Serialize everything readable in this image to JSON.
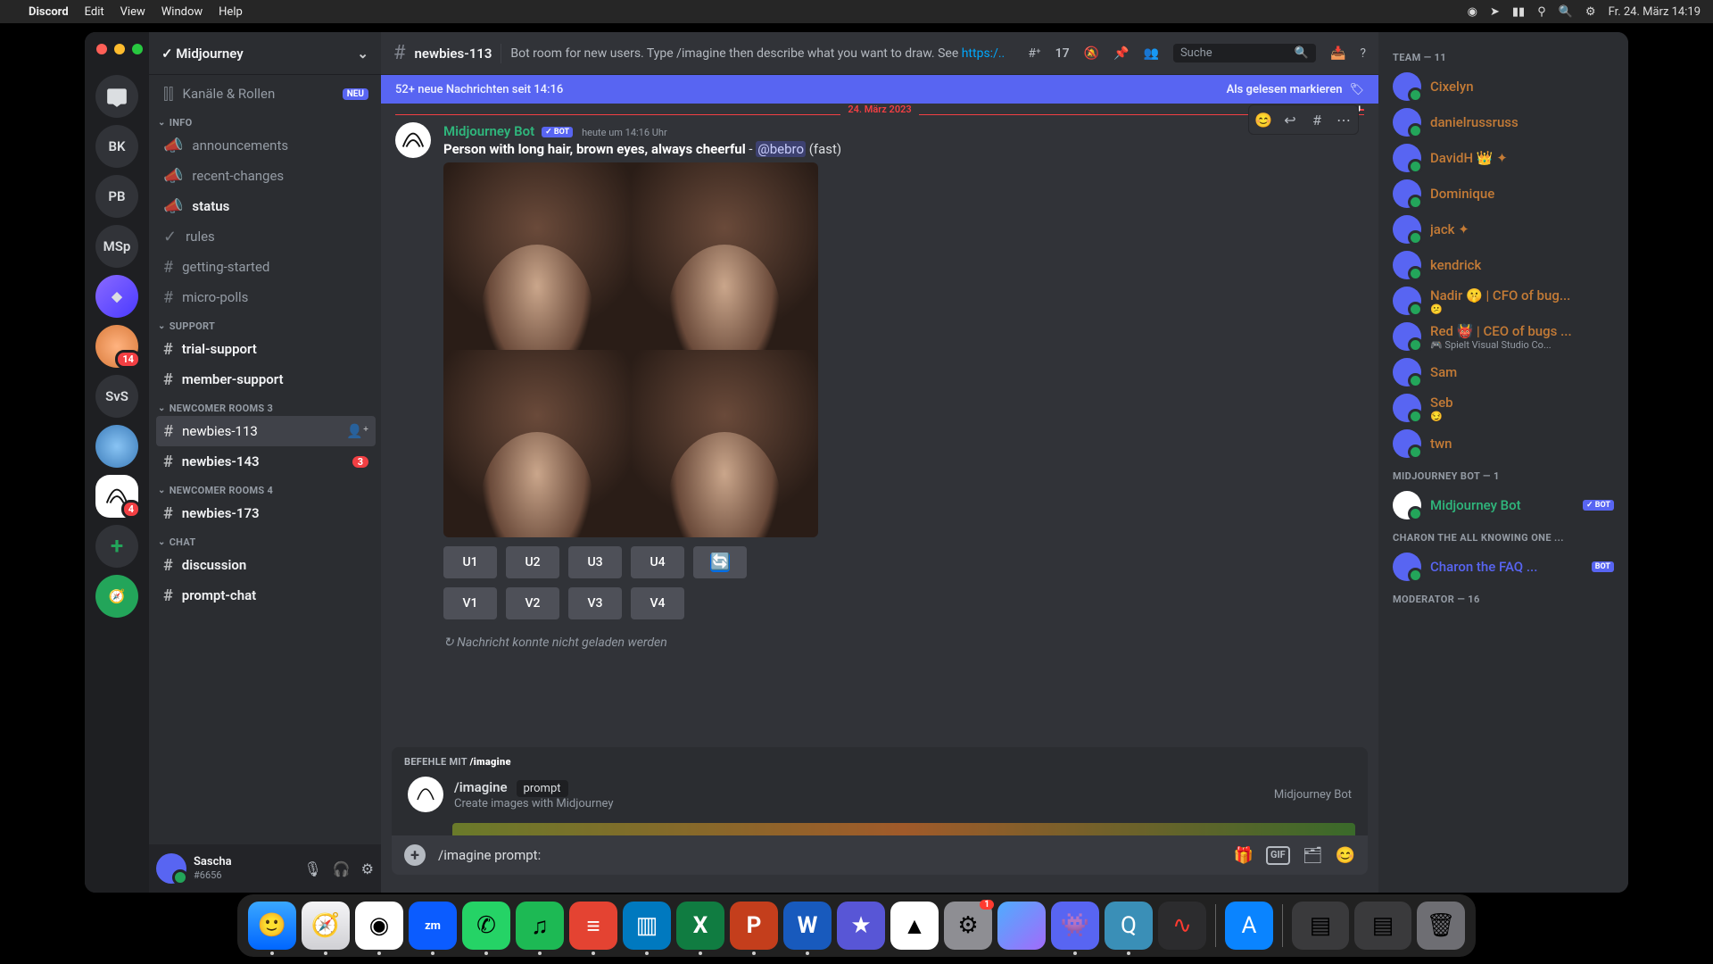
{
  "menubar": {
    "app": "Discord",
    "items": [
      "Edit",
      "View",
      "Window",
      "Help"
    ],
    "clock": "Fr. 24. März  14:19"
  },
  "server": {
    "name": "Midjourney"
  },
  "rail": {
    "items": [
      {
        "k": "home",
        "label": ""
      },
      {
        "k": "bk",
        "label": "BK"
      },
      {
        "k": "pb",
        "label": "PB"
      },
      {
        "k": "msp",
        "label": "MSp"
      },
      {
        "k": "guild1",
        "label": ""
      },
      {
        "k": "guild2",
        "label": "",
        "badge": "14"
      },
      {
        "k": "svs",
        "label": "SvS"
      },
      {
        "k": "guild3",
        "label": ""
      },
      {
        "k": "mj",
        "label": "",
        "badge": "4"
      }
    ]
  },
  "sidebar": {
    "channels_roles": "Kanäle & Rollen",
    "neu_pill": "NEU",
    "cats": [
      {
        "name": "INFO",
        "items": [
          {
            "icon": "megaphone",
            "label": "announcements"
          },
          {
            "icon": "megaphone",
            "label": "recent-changes"
          },
          {
            "icon": "megaphone",
            "label": "status",
            "bold": true
          },
          {
            "icon": "check",
            "label": "rules"
          },
          {
            "icon": "hash",
            "label": "getting-started"
          },
          {
            "icon": "hash",
            "label": "micro-polls"
          }
        ]
      },
      {
        "name": "SUPPORT",
        "items": [
          {
            "icon": "hash",
            "label": "trial-support",
            "bold": true
          },
          {
            "icon": "hash",
            "label": "member-support",
            "bold": true
          }
        ]
      },
      {
        "name": "NEWCOMER ROOMS 3",
        "items": [
          {
            "icon": "hash",
            "label": "newbies-113",
            "active": true,
            "addperson": true
          },
          {
            "icon": "hash",
            "label": "newbies-143",
            "bold": true,
            "count": "3"
          }
        ]
      },
      {
        "name": "NEWCOMER ROOMS 4",
        "items": [
          {
            "icon": "hash",
            "label": "newbies-173",
            "bold": true
          }
        ]
      },
      {
        "name": "CHAT",
        "items": [
          {
            "icon": "hash",
            "label": "discussion",
            "bold": true
          },
          {
            "icon": "hash",
            "label": "prompt-chat",
            "bold": true
          }
        ]
      }
    ]
  },
  "user": {
    "name": "Sascha",
    "tag": "#6656"
  },
  "channel": {
    "hash": "#",
    "name": "newbies-113",
    "topic_pre": "Bot room for new users. Type /imagine then describe what you want to draw. See ",
    "topic_link": "https:/..",
    "threads_count": "17",
    "search_placeholder": "Suche"
  },
  "banner": {
    "text": "52+ neue Nachrichten seit 14:16",
    "mark": "Als gelesen markieren"
  },
  "date_divider": "24. März 2023",
  "neu_badge": "NEU",
  "msg": {
    "author": "Midjourney Bot",
    "bot": "✓ BOT",
    "time": "heute um 14:16 Uhr",
    "prompt_bold": "Person with long hair, brown eyes, always cheerful",
    "prompt_sep": " - ",
    "mention": "@bebro",
    "suffix": " (fast)",
    "u": [
      "U1",
      "U2",
      "U3",
      "U4"
    ],
    "v": [
      "V1",
      "V2",
      "V3",
      "V4"
    ]
  },
  "loadfail": "Nachricht konnte nicht geladen werden",
  "cmd": {
    "title_pre": "BEFEHLE MIT ",
    "title_cmd": "/imagine",
    "name": "/imagine",
    "param": "prompt",
    "desc": "Create images with Midjourney",
    "source": "Midjourney Bot"
  },
  "input": "/imagine prompt:",
  "members": {
    "team_h": "TEAM — 11",
    "team": [
      {
        "n": "Cixelyn",
        "s": ""
      },
      {
        "n": "danielrussruss",
        "s": ""
      },
      {
        "n": "DavidH 👑 ✦",
        "s": ""
      },
      {
        "n": "Dominique",
        "s": ""
      },
      {
        "n": "jack ✦",
        "s": ""
      },
      {
        "n": "kendrick",
        "s": ""
      },
      {
        "n": "Nadir 🤫 | CFO of bug...",
        "s": "😕"
      },
      {
        "n": "Red 👹 | CEO of bugs ...",
        "s": "🎮 Spielt Visual Studio Co..."
      },
      {
        "n": "Sam",
        "s": ""
      },
      {
        "n": "Seb",
        "s": "😏"
      },
      {
        "n": "twn",
        "s": ""
      }
    ],
    "bot_h": "MIDJOURNEY BOT — 1",
    "bot": "Midjourney Bot",
    "bot_badge": "✓ BOT",
    "charon_h": "CHARON THE ALL KNOWING ONE ...",
    "charon": "Charon the FAQ ...",
    "mod_h": "MODERATOR — 16"
  },
  "dock": [
    "finder",
    "safari",
    "chrome",
    "zoom",
    "wa",
    "spot",
    "todo",
    "trello",
    "xls",
    "ppt",
    "word",
    "imov",
    "drive",
    "sys",
    "siri",
    "disc",
    "qt",
    "voice",
    "",
    "app"
  ]
}
